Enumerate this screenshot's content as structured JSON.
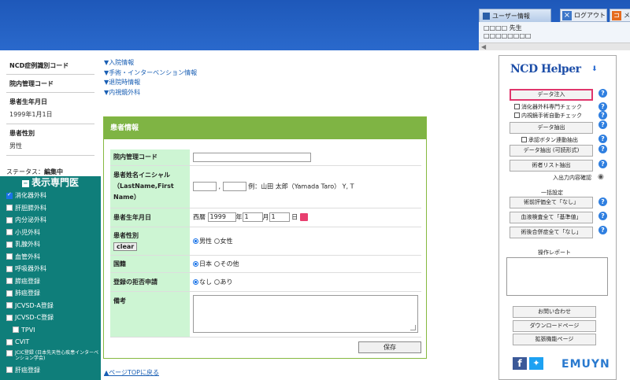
{
  "header": {
    "user_tab": "ユーザー情報",
    "logout": "ログアウト",
    "menu": "メニ",
    "user_name": "□□□□ 先生",
    "user_sub": "□□□□□□□□"
  },
  "left": {
    "fields": [
      {
        "label": "NCD症例識別コード",
        "value": ""
      },
      {
        "label": "院内管理コード",
        "value": ""
      },
      {
        "label": "患者生年月日",
        "value": "1999年1月1日"
      },
      {
        "label": "患者性別",
        "value": "男性"
      }
    ],
    "status_label": "ステータス：",
    "status_value": "編集中"
  },
  "specialty": {
    "title": "表示専門医",
    "items": [
      {
        "label": "消化器外科",
        "checked": true
      },
      {
        "label": "肝胆膵外科",
        "checked": false
      },
      {
        "label": "内分泌外科",
        "checked": false
      },
      {
        "label": "小児外科",
        "checked": false
      },
      {
        "label": "乳腺外科",
        "checked": false
      },
      {
        "label": "血管外科",
        "checked": false
      },
      {
        "label": "呼吸器外科",
        "checked": false
      },
      {
        "label": "膵癌登録",
        "checked": false
      },
      {
        "label": "肺癌登録",
        "checked": false
      },
      {
        "label": "JCVSD-A登録",
        "checked": false
      },
      {
        "label": "JCVSD-C登録",
        "checked": false
      },
      {
        "label": "TPVI",
        "checked": false
      },
      {
        "label": "CVIT",
        "checked": false
      },
      {
        "label": "JCIC登録 (日本先天性心疾患インターベンション学会)",
        "checked": false
      },
      {
        "label": "肝癌登録",
        "checked": false
      }
    ]
  },
  "nav": [
    "▼入院情報",
    "▼手術・インターベンション情報",
    "▼退院時情報",
    "▼内視鏡外科"
  ],
  "panel": {
    "title": "患者情報",
    "rows": {
      "code_label": "院内管理コード",
      "initial_label": "患者姓名イニシャル（LastName,First Name）",
      "initial_example": "例：山田 太郎（Yamada Taro） Y, T",
      "dob_label": "患者生年月日",
      "dob_era": "西暦",
      "dob_year": "1999",
      "dob_year_unit": "年",
      "dob_month": "1",
      "dob_month_unit": "月",
      "dob_day": "1",
      "dob_day_unit": "日",
      "sex_label": "患者性別",
      "sex_clear": "clear",
      "sex_male": "男性",
      "sex_female": "女性",
      "nation_label": "国籍",
      "nation_japan": "日本",
      "nation_other": "その他",
      "refusal_label": "登録の拒否申請",
      "refusal_none": "なし",
      "refusal_yes": "あり",
      "note_label": "備考"
    },
    "save": "保存"
  },
  "back_top": "▲ページTOPに戻る",
  "helper": {
    "logo": "NCD Helper",
    "data_inject": "データ注入",
    "check_gi": "消化器外科専門チェック",
    "check_endo": "内視鏡手術自動チェック",
    "data_extract": "データ抽出",
    "check_unapproved": "承認ボタン連動抽出",
    "data_extract_fmt": "データ抽出 (可読形式)",
    "surgeon_list": "術者リスト抽出",
    "io_check": "入出力内容確認",
    "bulk_title": "一括設定",
    "bulk_eval": "術前評価全て「なし」",
    "bulk_blood": "血液検査全て「基準値」",
    "bulk_comp": "術後合併症全て「なし」",
    "report_title": "操作レポート",
    "contact": "お問い合わせ",
    "download": "ダウンロードページ",
    "extension": "拡張機能ページ",
    "brand": "EMUYN"
  }
}
